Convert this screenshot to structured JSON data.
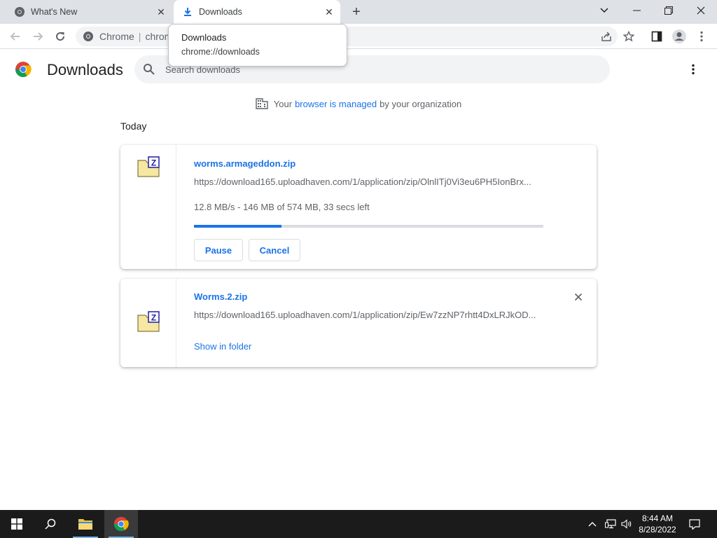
{
  "tabs": [
    {
      "title": "What's New",
      "icon": "chrome-icon"
    },
    {
      "title": "Downloads",
      "icon": "download-icon"
    }
  ],
  "omnibox": {
    "site_label": "Chrome",
    "url_fragment": "chrom"
  },
  "tooltip": {
    "title": "Downloads",
    "url": "chrome://downloads"
  },
  "header": {
    "title": "Downloads",
    "search_placeholder": "Search downloads"
  },
  "managed": {
    "prefix": "Your",
    "link": "browser is managed",
    "suffix": "by your organization"
  },
  "section_date": "Today",
  "downloads": [
    {
      "name": "worms.armageddon.zip",
      "url": "https://download165.uploadhaven.com/1/application/zip/OlnlITj0Vi3eu6PH5IonBrx...",
      "status": "12.8 MB/s - 146 MB of 574 MB, 33 secs left",
      "progress": 0.25,
      "pause_label": "Pause",
      "cancel_label": "Cancel"
    },
    {
      "name": "Worms.2.zip",
      "url": "https://download165.uploadhaven.com/1/application/zip/Ew7zzNP7rhtt4DxLRJkOD...",
      "show_label": "Show in folder"
    }
  ],
  "taskbar": {
    "time": "8:44 AM",
    "date": "8/28/2022"
  },
  "colors": {
    "accent": "#1a73e8",
    "tabstrip": "#dee1e6",
    "taskbar": "#1b1b1b"
  }
}
